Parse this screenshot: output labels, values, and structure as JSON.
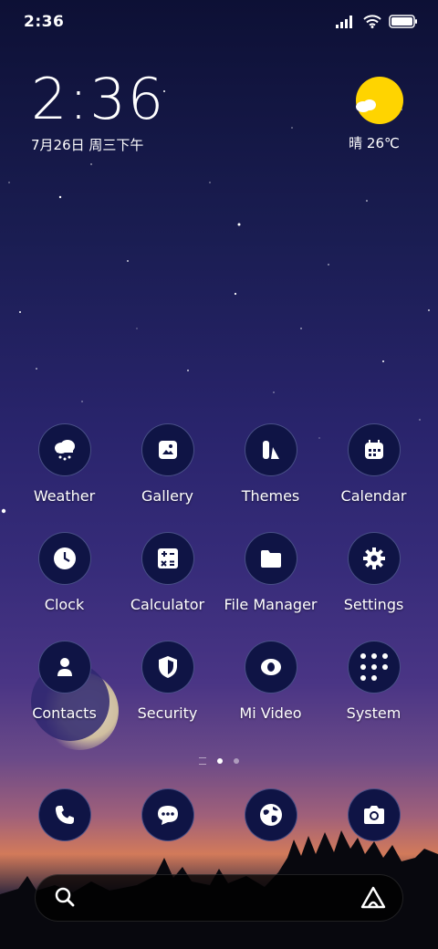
{
  "status_bar": {
    "time": "2:36"
  },
  "clock_widget": {
    "time": "2:36",
    "date": "7月26日 周三下午"
  },
  "weather_widget": {
    "text": "晴 26℃"
  },
  "apps": [
    {
      "label": "Weather",
      "icon": "cloud-rain-icon"
    },
    {
      "label": "Gallery",
      "icon": "image-icon"
    },
    {
      "label": "Themes",
      "icon": "brush-icon"
    },
    {
      "label": "Calendar",
      "icon": "calendar-icon"
    },
    {
      "label": "Clock",
      "icon": "clock-icon"
    },
    {
      "label": "Calculator",
      "icon": "calculator-icon"
    },
    {
      "label": "File Manager",
      "icon": "folder-icon"
    },
    {
      "label": "Settings",
      "icon": "gear-icon"
    },
    {
      "label": "Contacts",
      "icon": "person-icon"
    },
    {
      "label": "Security",
      "icon": "shield-icon"
    },
    {
      "label": "Mi Video",
      "icon": "video-icon"
    },
    {
      "label": "System",
      "icon": "folder-grid-icon"
    }
  ],
  "dock": [
    {
      "icon": "phone-icon"
    },
    {
      "icon": "message-icon"
    },
    {
      "icon": "globe-icon"
    },
    {
      "icon": "camera-icon"
    }
  ],
  "page_indicator": {
    "pages": 2,
    "current": 1
  },
  "colors": {
    "icon_bg": "#0f1445",
    "sun": "#ffd400"
  }
}
